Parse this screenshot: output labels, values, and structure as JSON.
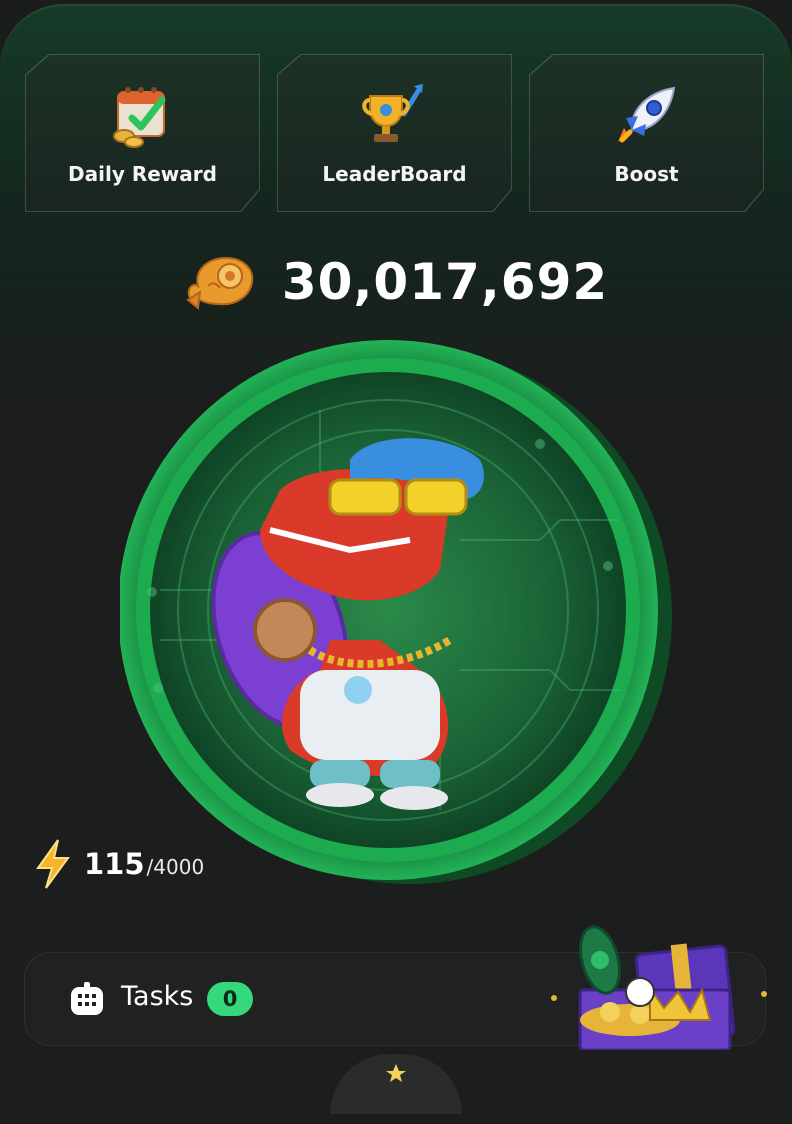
{
  "cards": [
    {
      "label": "Daily Reward",
      "icon": "calendar-check-icon"
    },
    {
      "label": "LeaderBoard",
      "icon": "trophy-chart-icon"
    },
    {
      "label": "Boost",
      "icon": "rocket-icon"
    }
  ],
  "balance": {
    "value": "30,017,692",
    "icon": "taiyaki-coin-icon"
  },
  "energy": {
    "current": "115",
    "max": "/4000",
    "icon": "lightning-icon"
  },
  "tasks": {
    "label": "Tasks",
    "count": "0",
    "icon": "tasks-grid-icon"
  },
  "colors": {
    "accent_green": "#33d97a",
    "coin_green": "#1fa34f",
    "background": "#1b1c1c"
  }
}
